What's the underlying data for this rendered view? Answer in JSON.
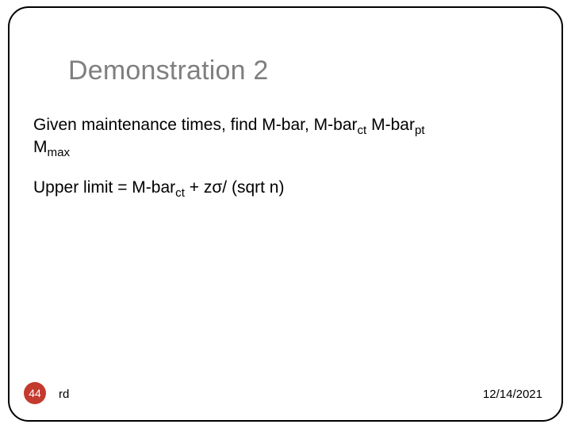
{
  "title": "Demonstration 2",
  "body": {
    "line1_a": "Given maintenance times, find M-bar, M-bar",
    "line1_sub1": "ct",
    "line1_b": " M-bar",
    "line1_sub2": "pt",
    "line2_a": "M",
    "line2_sub": "max",
    "line3_a": "Upper limit = M-bar",
    "line3_sub": "ct",
    "line3_b": " + zσ/ (sqrt n)"
  },
  "footer": {
    "page": "44",
    "author": "rd",
    "date": "12/14/2021"
  }
}
